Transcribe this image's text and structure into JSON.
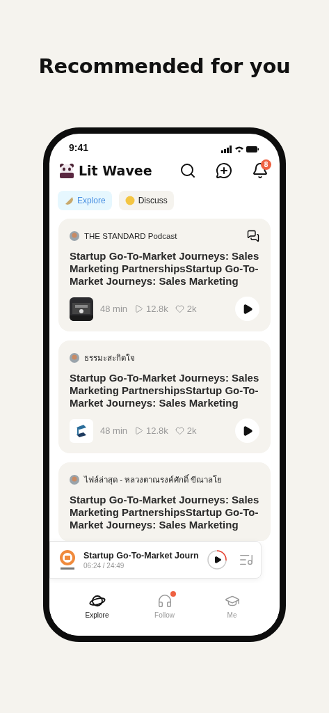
{
  "heading": "Recommended for you",
  "status_bar": {
    "time": "9:41"
  },
  "app_bar": {
    "title": "Lit Wavee",
    "notification_count": "8"
  },
  "tabs": [
    {
      "label": "Explore",
      "selected": true
    },
    {
      "label": "Discuss",
      "selected": false
    }
  ],
  "cards": [
    {
      "channel": "THE STANDARD Podcast",
      "has_comments": true,
      "title": "Startup Go-To-Market Journeys: Sales Marketing PartnershipsStartup Go-To-Market Journeys: Sales Marketing",
      "meta": {
        "duration": "48 min",
        "plays": "12.8k",
        "likes": "2k"
      }
    },
    {
      "channel": "ธรรมะสะกิดใจ",
      "has_comments": false,
      "title": "Startup Go-To-Market Journeys: Sales Marketing PartnershipsStartup Go-To-Market Journeys: Sales Marketing",
      "meta": {
        "duration": "48 min",
        "plays": "12.8k",
        "likes": "2k"
      }
    },
    {
      "channel": "ไฟล์ล่าสุด - หลวงตาณรงค์ศักดิ์ ขีณาลโย",
      "has_comments": false,
      "title": "Startup Go-To-Market Journeys: Sales Marketing PartnershipsStartup Go-To-Market Journeys: Sales Marketing"
    }
  ],
  "player": {
    "title": "Startup Go-To-Market Journ",
    "time": "06:24 / 24:49"
  },
  "nav": [
    {
      "label": "Explore",
      "selected": true,
      "dot": false
    },
    {
      "label": "Follow",
      "selected": false,
      "dot": true
    },
    {
      "label": "Me",
      "selected": false,
      "dot": false
    }
  ]
}
